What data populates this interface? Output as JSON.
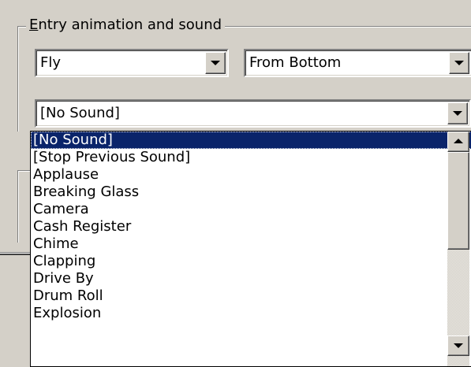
{
  "group": {
    "legend_mnemonic": "E",
    "legend_rest": "ntry animation and sound"
  },
  "effect_select": {
    "value": "Fly"
  },
  "direction_select": {
    "value": "From Bottom"
  },
  "sound_select": {
    "value": "[No Sound]"
  },
  "sound_list": {
    "items": [
      "[No Sound]",
      "[Stop Previous Sound]",
      "Applause",
      "Breaking Glass",
      "Camera",
      "Cash Register",
      "Chime",
      "Clapping",
      "Drive By",
      "Drum Roll",
      "Explosion"
    ],
    "selected_index": 0
  },
  "icons": {
    "dropdown": "chevron-down-icon",
    "scroll_up": "arrow-up-icon",
    "scroll_down": "arrow-down-icon"
  },
  "colors": {
    "selection_bg": "#0a246a",
    "selection_fg": "#ffffff",
    "face": "#d4d0c8"
  }
}
